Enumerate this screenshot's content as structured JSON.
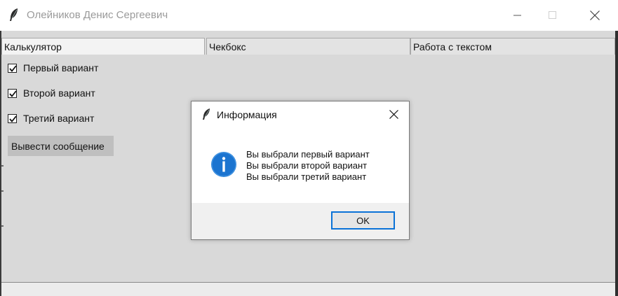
{
  "window": {
    "title": "Олейников Денис Сергеевич"
  },
  "tabs": [
    {
      "label": "Калькулятор"
    },
    {
      "label": "Чекбокс"
    },
    {
      "label": "Работа с текстом"
    }
  ],
  "checkboxes": [
    {
      "label": "Первый вариант",
      "checked": true
    },
    {
      "label": "Второй вариант",
      "checked": true
    },
    {
      "label": "Третий вариант",
      "checked": true
    }
  ],
  "buttons": {
    "show_message": "Вывести сообщение"
  },
  "dialog": {
    "title": "Информация",
    "icon": "info-icon",
    "lines": [
      "Вы выбрали первый вариант",
      "Вы выбрали второй вариант",
      "Вы выбрали третий вариант"
    ],
    "ok_label": "OK"
  },
  "colors": {
    "accent": "#0a72d7",
    "info_icon": "#1b74d0",
    "client_bg": "#d9d9d9"
  }
}
